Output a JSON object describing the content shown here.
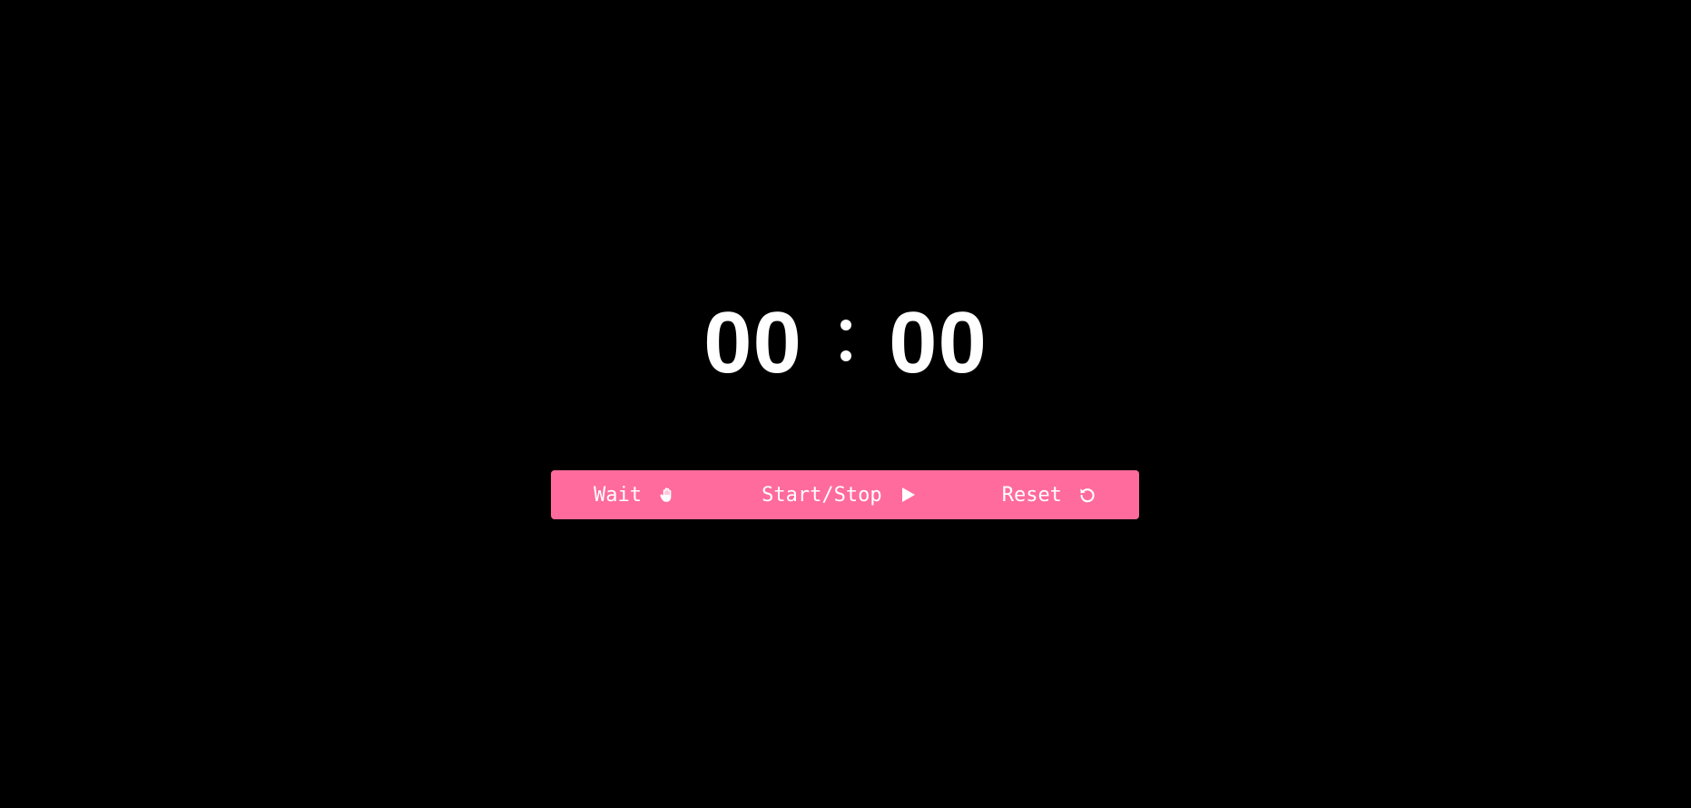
{
  "timer": {
    "minutes": "00",
    "seconds": "00"
  },
  "controls": {
    "wait_label": "Wait",
    "start_stop_label": "Start/Stop",
    "reset_label": "Reset"
  },
  "icons": {
    "wait": "hand-icon",
    "start_stop": "play-icon",
    "reset": "reset-icon"
  },
  "colors": {
    "background": "#000000",
    "accent": "#ff6b9c",
    "text": "#ffffff"
  }
}
